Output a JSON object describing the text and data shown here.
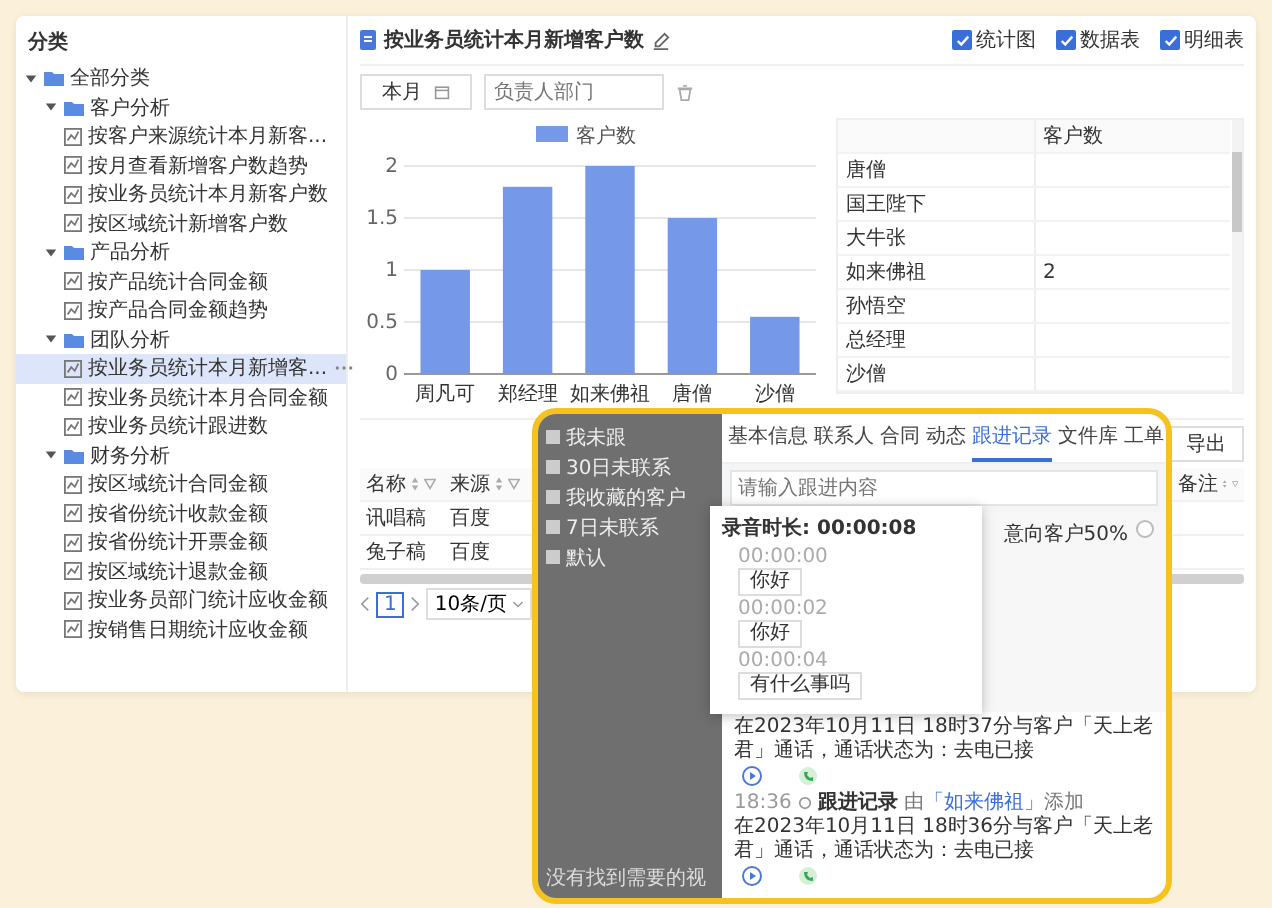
{
  "tree": {
    "title": "分类",
    "items": [
      {
        "label": "全部分类",
        "expanded": true,
        "children": [
          {
            "label": "客户分析",
            "expanded": true,
            "children": [
              {
                "label": "按客户来源统计本月新客...",
                "selected": false
              },
              {
                "label": "按月查看新增客户数趋势",
                "selected": false
              },
              {
                "label": "按业务员统计本月新客户数",
                "selected": false
              },
              {
                "label": "按区域统计新增客户数",
                "selected": false
              }
            ]
          },
          {
            "label": "产品分析",
            "expanded": true,
            "children": [
              {
                "label": "按产品统计合同金额",
                "selected": false
              },
              {
                "label": "按产品合同金额趋势",
                "selected": false
              }
            ]
          },
          {
            "label": "团队分析",
            "expanded": true,
            "children": [
              {
                "label": "按业务员统计本月新增客...",
                "selected": true
              },
              {
                "label": "按业务员统计本月合同金额",
                "selected": false
              },
              {
                "label": "按业务员统计跟进数",
                "selected": false
              }
            ]
          },
          {
            "label": "财务分析",
            "expanded": true,
            "children": [
              {
                "label": "按区域统计合同金额",
                "selected": false
              },
              {
                "label": "按省份统计收款金额",
                "selected": false
              },
              {
                "label": "按省份统计开票金额",
                "selected": false
              },
              {
                "label": "按区域统计退款金额",
                "selected": false
              },
              {
                "label": "按业务员部门统计应收金额",
                "selected": false
              },
              {
                "label": "按销售日期统计应收金额",
                "selected": false
              }
            ]
          }
        ]
      }
    ]
  },
  "report": {
    "title": "按业务员统计本月新增客户数",
    "views": [
      {
        "label": "统计图",
        "checked": true
      },
      {
        "label": "数据表",
        "checked": true
      },
      {
        "label": "明细表",
        "checked": true
      }
    ]
  },
  "filters": {
    "period": "本月",
    "department": {
      "placeholder": "负责人部门"
    }
  },
  "chart": {
    "chart_data": {
      "type": "bar",
      "categories": [
        "周凡可",
        "郑经理",
        "如来佛祖",
        "唐僧",
        "沙僧"
      ],
      "series": [
        {
          "name": "客户数",
          "color": "#7598e8",
          "values": [
            1,
            1.8,
            2,
            1.5,
            0.55
          ]
        }
      ],
      "ylim": [
        0,
        2
      ],
      "grid": true,
      "yticks": [
        0,
        0.5,
        1,
        1.5,
        2
      ]
    }
  },
  "data_table": {
    "columns": [
      "客户数"
    ],
    "rows": [
      {
        "name": "唐僧"
      },
      {
        "name": "国王陛下"
      },
      {
        "name": "大牛张"
      },
      {
        "name": "如来佛祖",
        "count": "2"
      },
      {
        "name": "孙悟空"
      },
      {
        "name": "总经理"
      },
      {
        "name": "沙僧"
      }
    ]
  },
  "detail": {
    "export": "导出",
    "columns": [
      "名称",
      "来源",
      "备注"
    ],
    "rows": [
      [
        "讯唱稿",
        "百度"
      ],
      [
        "兔子稿",
        "百度"
      ]
    ],
    "pagination": {
      "pages": [
        {
          "label": "1",
          "selected": true
        }
      ],
      "page_size": "10条/页"
    }
  },
  "overlay": {
    "views": [
      "我未跟",
      "30日未联系",
      "我收藏的客户",
      "7日未联系",
      "默认"
    ],
    "hint": "没有找到需要的视",
    "tabs": [
      {
        "label": "基本信息",
        "selected": false
      },
      {
        "label": "联系人",
        "selected": false
      },
      {
        "label": "合同",
        "selected": false
      },
      {
        "label": "动态",
        "selected": false
      },
      {
        "label": "跟进记录",
        "selected": true
      },
      {
        "label": "文件库",
        "selected": false
      },
      {
        "label": "工单",
        "selected": false
      }
    ],
    "input": {
      "placeholder": "请输入跟进内容"
    },
    "intent": {
      "label": "意向客户50%",
      "selected": false
    },
    "recording": {
      "title": "录音时长: 00:00:08",
      "lines": [
        {
          "time": "00:00:00",
          "text": "你好"
        },
        {
          "time": "00:00:02",
          "text": "你好"
        },
        {
          "time": "00:00:04",
          "text": "有什么事吗"
        }
      ]
    },
    "timeline": [
      {
        "text": "在2023年10月11日 18时37分与客户「天上老君」通话，通话状态为：去电已接"
      },
      {
        "time": "18:36",
        "title": "跟进记录",
        "by": "由",
        "author": "「如来佛祖」",
        "suffix": "添加",
        "text": "在2023年10月11日 18时36分与客户「天上老君」通话，通话状态为：去电已接"
      }
    ]
  }
}
